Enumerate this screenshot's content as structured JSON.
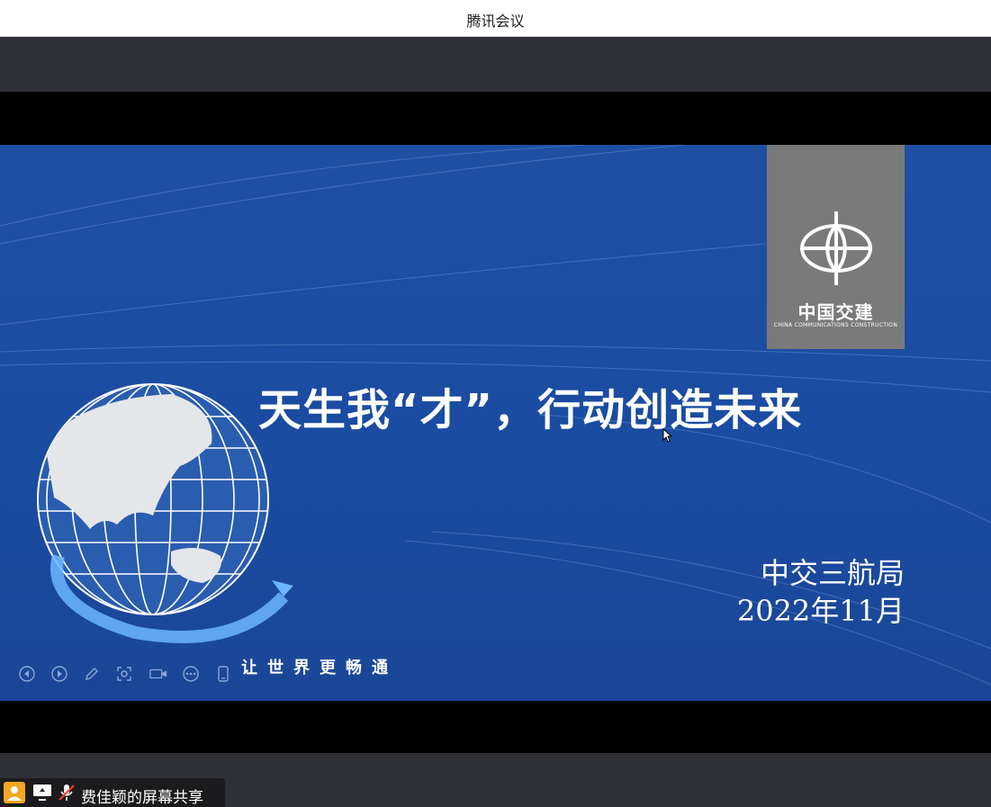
{
  "window": {
    "title": "腾讯会议"
  },
  "slide": {
    "logo": {
      "name_cn": "中国交建",
      "name_en": "CHINA COMMUNICATIONS CONSTRUCTION"
    },
    "headline": "天生我“才”，行动创造未来",
    "organization": "中交三航局",
    "date": "2022年11月",
    "slogan": "让世界更畅通"
  },
  "presenter_toolbar": {
    "icons": [
      "prev-icon",
      "next-icon",
      "pen-icon",
      "zoom-icon",
      "camera-icon",
      "more-icon",
      "phone-icon"
    ]
  },
  "share_status": {
    "label": "费佳颖的屏幕共享"
  },
  "colors": {
    "slide_blue": "#1e4fa3",
    "logo_gray": "#7a7a7a",
    "letterbox": "#000000",
    "stage_dark": "#2e3036",
    "avatar_orange": "#f5a623"
  }
}
